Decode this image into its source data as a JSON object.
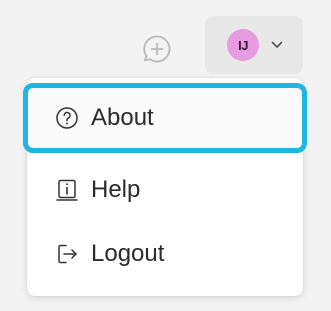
{
  "header": {
    "new_chat_icon": "chat-plus-icon",
    "user": {
      "avatar_initials": "IJ",
      "avatar_color": "#e79be0",
      "chevron_icon": "chevron-down-icon"
    }
  },
  "menu": {
    "items": [
      {
        "label": "About",
        "icon": "question-circle-icon",
        "focused": true
      },
      {
        "label": "Help",
        "icon": "info-box-icon",
        "focused": false
      },
      {
        "label": "Logout",
        "icon": "logout-arrow-icon",
        "focused": false
      }
    ],
    "focus_color": "#1fb6e3"
  }
}
